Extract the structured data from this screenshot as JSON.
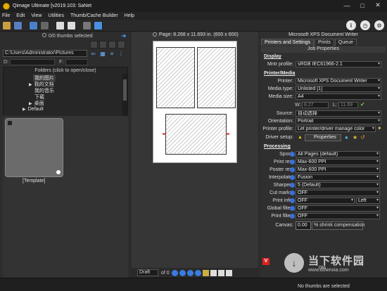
{
  "window": {
    "title": "Qimage Ultimate [v2019.103: SaNet",
    "controls": [
      "—",
      "□",
      "✕"
    ]
  },
  "menu": [
    "File",
    "Edit",
    "View",
    "Utilities",
    "Thumb/Cache Builder",
    "Help"
  ],
  "left": {
    "thumbs_selected": "0/0 thumbs selected",
    "path": "C:\\Users\\Administrator\\Pictures",
    "drive_label": "D:",
    "filter_label": "F:",
    "folders_header": "Folders (click to open/close)",
    "folders": [
      {
        "label": "我的图片",
        "selected": true
      },
      {
        "label": "我的文档",
        "selected": false
      },
      {
        "label": "我的音乐",
        "selected": false
      },
      {
        "label": "下载",
        "selected": false
      },
      {
        "label": "桌面",
        "selected": false
      },
      {
        "label": "Default",
        "selected": false
      }
    ],
    "thumb_label": "[Template]"
  },
  "center": {
    "page_info": "Page: 8.268 x 11.693 in.  (600 x 600)",
    "bottom_mode": "Draft",
    "bottom_of": "of 0"
  },
  "right": {
    "printer_title": "Microsoft XPS Document Writer",
    "tabs": [
      "Printers and Settings",
      "Prints",
      "Queue"
    ],
    "job_properties": "Job Properties",
    "display": {
      "section": "Display",
      "monitor_profile_label": "Mntr profile:",
      "monitor_profile": "sRGB IEC61966-2.1"
    },
    "printer_media": {
      "section": "Printer/Media",
      "printer_label": "Printer:",
      "printer": "Microsoft XPS Document Writer",
      "media_type_label": "Media type:",
      "media_type": "Unlisted [1]",
      "media_size_label": "Media size:",
      "media_size": "A4",
      "w_label": "W:",
      "w_value": "8.27",
      "l_label": "L:",
      "l_value": "11.69",
      "source_label": "Source:",
      "source": "自动选择",
      "orientation_label": "Orientation:",
      "orientation": "Portrait",
      "printer_profile_label": "Printer profile:",
      "printer_profile": "Let printer/driver manage color",
      "driver_setup_label": "Driver setup:",
      "driver_setup_button": "Properties"
    },
    "processing": {
      "section": "Processing",
      "rows": [
        {
          "label": "Spool:",
          "value": "All Pages (default)"
        },
        {
          "label": "Print res:",
          "value": "Max-600 PPI"
        },
        {
          "label": "Poster res:",
          "value": "Max-600 PPI"
        },
        {
          "label": "Interpolate:",
          "value": "Fusion"
        },
        {
          "label": "Sharpen:",
          "value": "5 (Default)"
        },
        {
          "label": "Cut marks:",
          "value": "OFF"
        },
        {
          "label": "Print info:",
          "value": "OFF"
        },
        {
          "label": "Global filter:",
          "value": "OFF"
        },
        {
          "label": "Print filter:",
          "value": "OFF"
        }
      ],
      "print_info_side": "Left",
      "canvas_label": "Canvas:",
      "canvas_value": "0.00",
      "shrink_label": "% shrink compensation"
    },
    "percent": "0%"
  },
  "status": {
    "message": "No thumbs are selected"
  },
  "watermark": {
    "cn": "当下软件园",
    "url": "www.downxia.com"
  }
}
